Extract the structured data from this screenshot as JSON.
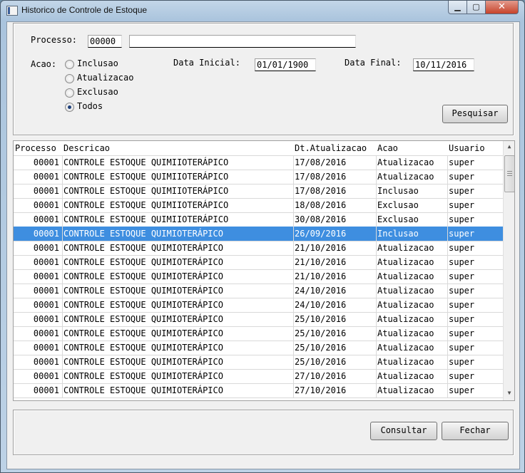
{
  "window": {
    "title": "Historico de Controle de Estoque"
  },
  "filters": {
    "processo_label": "Processo:",
    "processo_code": "00000",
    "processo_desc": "",
    "acao_label": "Acao:",
    "acao_options": [
      {
        "label": "Inclusao",
        "selected": false
      },
      {
        "label": "Atualizacao",
        "selected": false
      },
      {
        "label": "Exclusao",
        "selected": false
      },
      {
        "label": "Todos",
        "selected": true
      }
    ],
    "data_inicial_label": "Data Inicial:",
    "data_inicial": "01/01/1900",
    "data_final_label": "Data Final:",
    "data_final": "10/11/2016",
    "pesquisar_label": "Pesquisar"
  },
  "table": {
    "columns": [
      "Processo",
      "Descricao",
      "Dt.Atualizacao",
      "Acao",
      "Usuario"
    ],
    "selected_row": 5,
    "rows": [
      [
        "00001",
        "CONTROLE ESTOQUE QUIMIIOTERÁPICO",
        "17/08/2016",
        "Atualizacao",
        "super"
      ],
      [
        "00001",
        "CONTROLE ESTOQUE QUIMIIOTERÁPICO",
        "17/08/2016",
        "Atualizacao",
        "super"
      ],
      [
        "00001",
        "CONTROLE ESTOQUE QUIMIIOTERÁPICO",
        "17/08/2016",
        "Inclusao",
        "super"
      ],
      [
        "00001",
        "CONTROLE ESTOQUE QUIMIIOTERÁPICO",
        "18/08/2016",
        "Exclusao",
        "super"
      ],
      [
        "00001",
        "CONTROLE ESTOQUE QUIMIIOTERÁPICO",
        "30/08/2016",
        "Exclusao",
        "super"
      ],
      [
        "00001",
        "CONTROLE ESTOQUE QUIMIOTERÁPICO",
        "26/09/2016",
        "Inclusao",
        "super"
      ],
      [
        "00001",
        "CONTROLE ESTOQUE QUIMIOTERÁPICO",
        "21/10/2016",
        "Atualizacao",
        "super"
      ],
      [
        "00001",
        "CONTROLE ESTOQUE QUIMIOTERÁPICO",
        "21/10/2016",
        "Atualizacao",
        "super"
      ],
      [
        "00001",
        "CONTROLE ESTOQUE QUIMIOTERÁPICO",
        "21/10/2016",
        "Atualizacao",
        "super"
      ],
      [
        "00001",
        "CONTROLE ESTOQUE QUIMIOTERÁPICO",
        "24/10/2016",
        "Atualizacao",
        "super"
      ],
      [
        "00001",
        "CONTROLE ESTOQUE QUIMIOTERÁPICO",
        "24/10/2016",
        "Atualizacao",
        "super"
      ],
      [
        "00001",
        "CONTROLE ESTOQUE QUIMIOTERÁPICO",
        "25/10/2016",
        "Atualizacao",
        "super"
      ],
      [
        "00001",
        "CONTROLE ESTOQUE QUIMIOTERÁPICO",
        "25/10/2016",
        "Atualizacao",
        "super"
      ],
      [
        "00001",
        "CONTROLE ESTOQUE QUIMIOTERÁPICO",
        "25/10/2016",
        "Atualizacao",
        "super"
      ],
      [
        "00001",
        "CONTROLE ESTOQUE QUIMIOTERÁPICO",
        "25/10/2016",
        "Atualizacao",
        "super"
      ],
      [
        "00001",
        "CONTROLE ESTOQUE QUIMIOTERÁPICO",
        "27/10/2016",
        "Atualizacao",
        "super"
      ],
      [
        "00001",
        "CONTROLE ESTOQUE QUIMIOTERÁPICO",
        "27/10/2016",
        "Atualizacao",
        "super"
      ]
    ]
  },
  "footer": {
    "consultar_label": "Consultar",
    "fechar_label": "Fechar"
  },
  "icons": {
    "minimize": "minimize-icon",
    "maximize": "maximize-icon",
    "close": "close-icon"
  },
  "colors": {
    "selection": "#3e8ee0",
    "accent_radio": "#1d3f7a"
  }
}
